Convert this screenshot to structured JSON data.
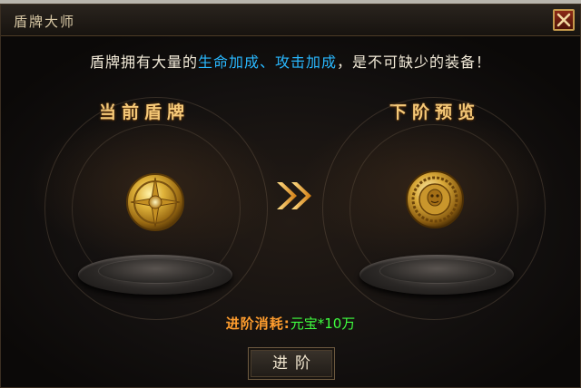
{
  "window": {
    "title": "盾牌大师"
  },
  "description": {
    "prefix": "盾牌拥有大量的",
    "highlight": "生命加成、攻击加成",
    "suffix": "，是不可缺少的装备！"
  },
  "current": {
    "title": "当前盾牌"
  },
  "next": {
    "title": "下阶预览"
  },
  "cost": {
    "label": "进阶消耗:",
    "value": "元宝*10万"
  },
  "advance_button": {
    "label": "进阶"
  },
  "colors": {
    "highlight": "#29b8ff",
    "section_title": "#f6c978",
    "cost_label": "#ff9d2e",
    "cost_value": "#3fff3f",
    "close_button": "#8c2a16"
  },
  "icons": {
    "close": "close-icon",
    "arrow": "double-chevron-right-icon",
    "current_shield": "golden-round-shield-icon",
    "next_shield": "ornate-golden-shield-icon"
  }
}
